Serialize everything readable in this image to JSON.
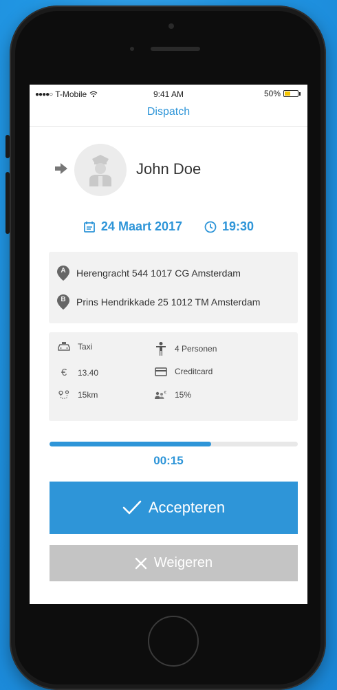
{
  "status_bar": {
    "signal": "●●●●○",
    "carrier": "T-Mobile",
    "time": "9:41 AM",
    "battery": "50%",
    "battery_level": 0.5
  },
  "nav": {
    "title": "Dispatch"
  },
  "driver": {
    "name": "John Doe"
  },
  "schedule": {
    "date": "24 Maart 2017",
    "time": "19:30"
  },
  "addresses": [
    {
      "marker": "A",
      "text": "Herengracht 544 1017 CG Amsterdam"
    },
    {
      "marker": "B",
      "text": "Prins Hendrikkade 25 1012 TM Amsterdam"
    }
  ],
  "details": {
    "vehicle": "Taxi",
    "passengers": "4 Personen",
    "price_symbol": "€",
    "price": "13.40",
    "payment": "Creditcard",
    "distance": "15km",
    "commission": "15%"
  },
  "timer": {
    "value": "00:15",
    "progress": 0.65
  },
  "actions": {
    "accept_label": "Accepteren",
    "reject_label": "Weigeren"
  },
  "colors": {
    "accent": "#2e95d8",
    "background": "#2196e3",
    "reject": "#c4c4c4",
    "card": "#f2f2f2"
  }
}
